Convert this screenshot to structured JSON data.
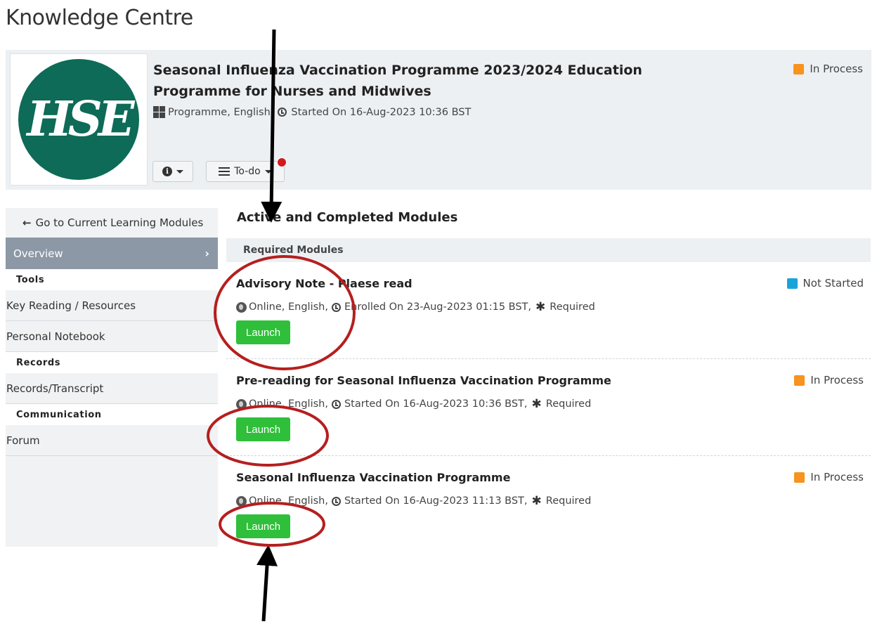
{
  "page": {
    "title": "Knowledge Centre"
  },
  "course": {
    "logo_text": "HSE",
    "title": "Seasonal Influenza Vaccination Programme 2023/2024 Education Programme for Nurses and Midwives",
    "meta": "Programme, English, ",
    "started": "Started On 16-Aug-2023 10:36 BST",
    "status": "In Process",
    "status_color": "#f7931e",
    "todo_label": "To-do"
  },
  "sidebar": {
    "back_label": "Go to Current Learning Modules",
    "overview_label": "Overview",
    "sections": {
      "tools": "Tools",
      "records": "Records",
      "communication": "Communication"
    },
    "items": {
      "key_reading": "Key Reading / Resources",
      "notebook": "Personal Notebook",
      "transcript": "Records/Transcript",
      "forum": "Forum"
    }
  },
  "main": {
    "heading": "Active and Completed Modules",
    "required_header": "Required Modules",
    "modules": [
      {
        "title": "Advisory Note - Plaese read",
        "status": "Not Started",
        "status_color": "#1aa3d9",
        "meta": "Online, English, ",
        "date": "Enrolled On 23-Aug-2023 01:15 BST, ",
        "required": "Required",
        "launch_label": "Launch"
      },
      {
        "title": "Pre-reading for Seasonal Influenza Vaccination Programme",
        "status": "In Process",
        "status_color": "#f7931e",
        "meta": "Online, English, ",
        "date": "Started On 16-Aug-2023 10:36 BST, ",
        "required": "Required",
        "launch_label": "Launch"
      },
      {
        "title": "Seasonal Influenza Vaccination Programme",
        "status": "In Process",
        "status_color": "#f7931e",
        "meta": "Online, English, ",
        "date": "Started On 16-Aug-2023 11:13 BST, ",
        "required": "Required",
        "launch_label": "Launch"
      }
    ]
  }
}
